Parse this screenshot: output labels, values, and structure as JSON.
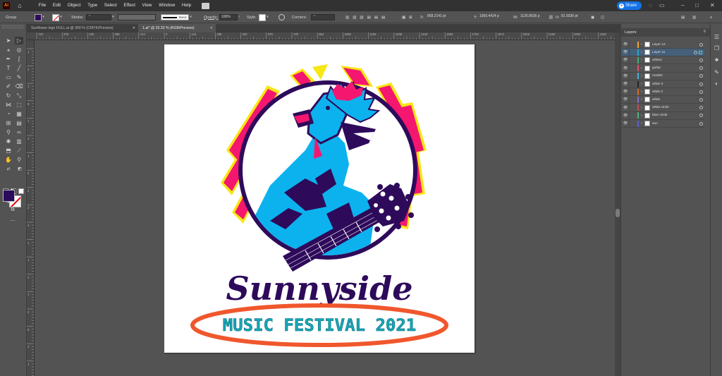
{
  "menubar": {
    "logo": "Ai",
    "items": [
      "File",
      "Edit",
      "Object",
      "Type",
      "Select",
      "Effect",
      "View",
      "Window",
      "Help"
    ],
    "share_label": "Share"
  },
  "controlbar": {
    "selection_label": "Group",
    "stroke_label": "Stroke:",
    "brush_label": "Basic",
    "opacity_label": "Opacity:",
    "opacity_value": "100%",
    "style_label": "Style:",
    "corners_label": "Corners:",
    "x_label": "X:",
    "x_value": "858.2141 pt",
    "y_label": "Y:",
    "y_value": "1565.4424 p",
    "w_label": "W:",
    "w_value": "1126.8636 p",
    "h_label": "H:",
    "h_value": "81.9336 pt"
  },
  "tabs": [
    {
      "label": "Sunflower logo FULL.ai @ 300 % (CMYK/Preview)",
      "active": false
    },
    {
      "label": "1.ai* @ 33.33 % (RGB/Preview)",
      "active": true
    }
  ],
  "ruler_top": [
    "720",
    "576",
    "432",
    "288",
    "144",
    "0",
    "144",
    "288",
    "432",
    "576",
    "720",
    "864",
    "1008",
    "1152",
    "1296",
    "1440",
    "1584",
    "1728",
    "1872",
    "2016",
    "2160",
    "2304",
    "2448"
  ],
  "ruler_left": [
    "1",
    "2",
    "1",
    "8",
    "1",
    "4",
    "1",
    "2",
    "4",
    "2",
    "4",
    "1",
    "1",
    "4",
    "1",
    "2",
    "8",
    "2",
    "1"
  ],
  "artwork": {
    "title_text": "Sunnyside",
    "subtitle_text": "MUSIC FESTIVAL 2021",
    "colors": {
      "purple": "#2e0a5b",
      "blue": "#0cb2ee",
      "pink": "#f5176f",
      "yellow": "#f7e714",
      "orange": "#f0572d",
      "teal": "#17a6b8"
    }
  },
  "layers_panel": {
    "title": "Layers",
    "layers": [
      {
        "name": "Layer 12",
        "color": "#f0a33a",
        "selected": false
      },
      {
        "name": "Layer 11",
        "color": "#2aa7c9",
        "selected": true
      },
      {
        "name": "white2",
        "color": "#44b07a",
        "selected": false
      },
      {
        "name": "guitar",
        "color": "#e05070",
        "selected": false
      },
      {
        "name": "rooster",
        "color": "#3fb2d8",
        "selected": false
      },
      {
        "name": "white 3",
        "color": "#222222",
        "selected": false
      },
      {
        "name": "white 2",
        "color": "#d9682a",
        "selected": false
      },
      {
        "name": "white",
        "color": "#8a6cc9",
        "selected": false
      },
      {
        "name": "white circle",
        "color": "#c05050",
        "selected": false
      },
      {
        "name": "blue circle",
        "color": "#4bb37a",
        "selected": false
      },
      {
        "name": "sun",
        "color": "#5a60d0",
        "selected": false
      }
    ]
  }
}
